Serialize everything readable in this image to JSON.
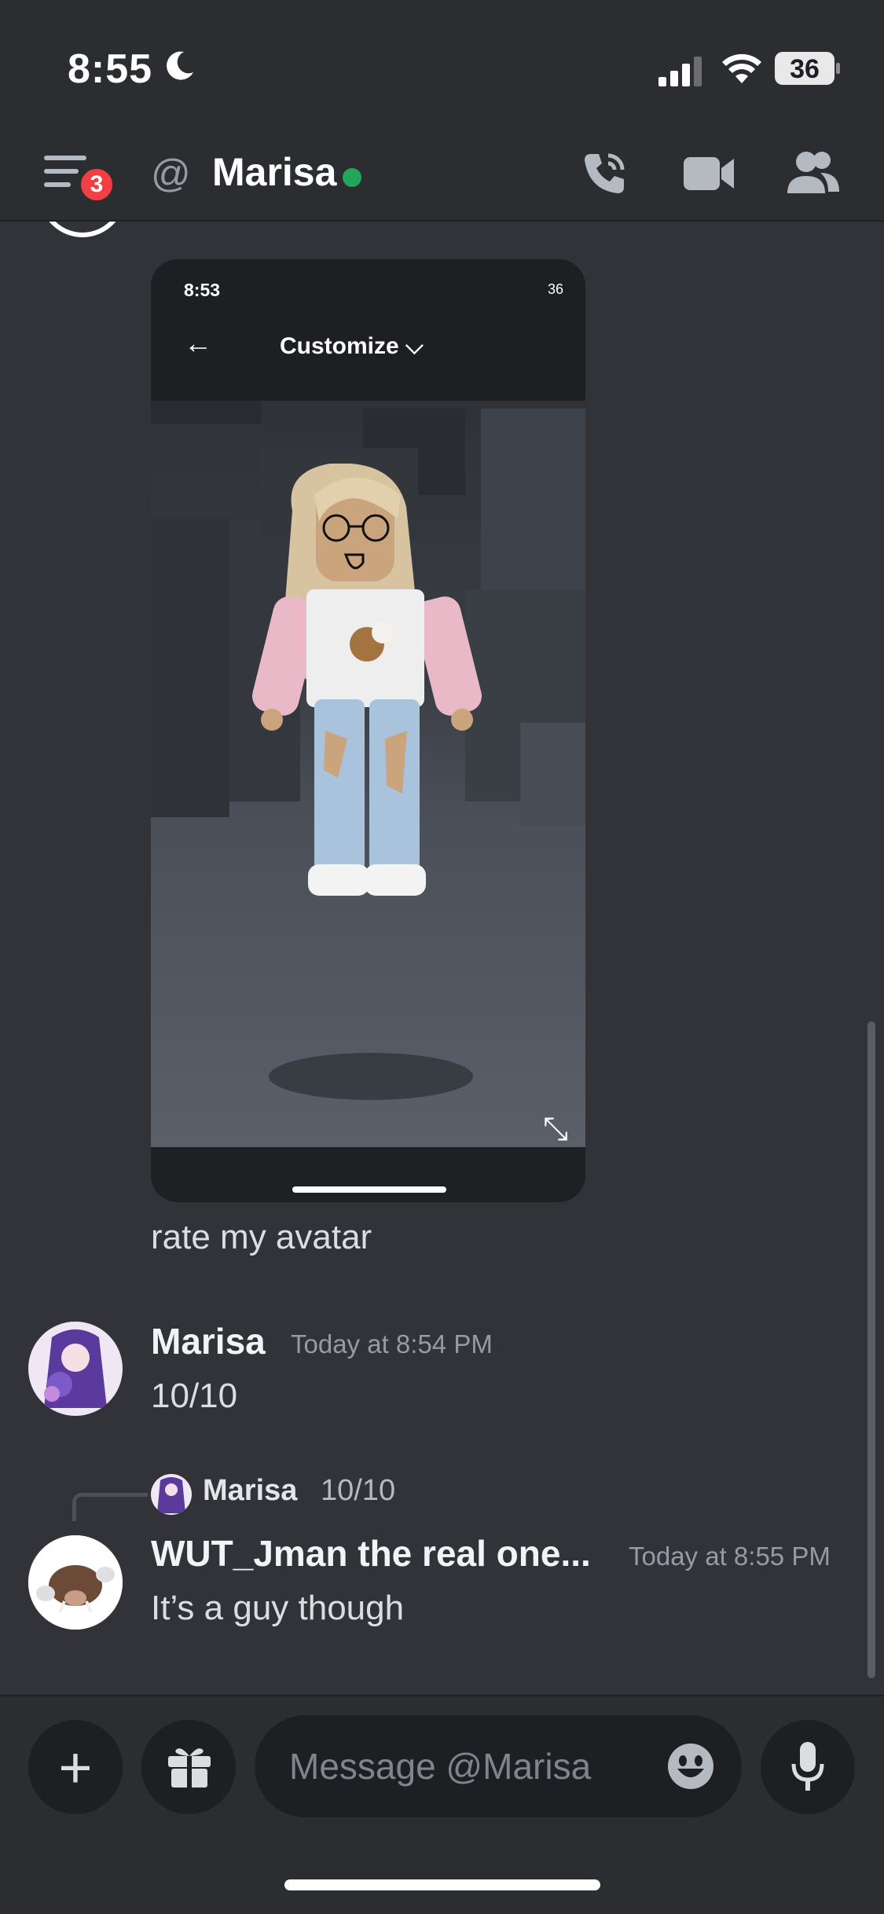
{
  "status_bar": {
    "time": "8:55",
    "battery": "36"
  },
  "header": {
    "badge_count": "3",
    "at_symbol": "@",
    "title": "Marisa"
  },
  "attachment": {
    "time": "8:53",
    "status": "36",
    "back": "←",
    "customize": "Customize ⌵",
    "expand": "⤡"
  },
  "messages": [
    {
      "text": "rate my avatar"
    },
    {
      "username": "Marisa",
      "timestamp": "Today at 8:54 PM",
      "text": "10/10"
    },
    {
      "reply_to": {
        "username": "Marisa",
        "text": "10/10"
      },
      "username": "WUT_Jman the real one...",
      "timestamp": "Today at 8:55 PM",
      "text": "It’s a guy though"
    }
  ],
  "composer": {
    "placeholder": "Message @Marisa"
  },
  "colors": {
    "online": "#23a55a",
    "badge": "#f23f43",
    "background": "#313338"
  }
}
